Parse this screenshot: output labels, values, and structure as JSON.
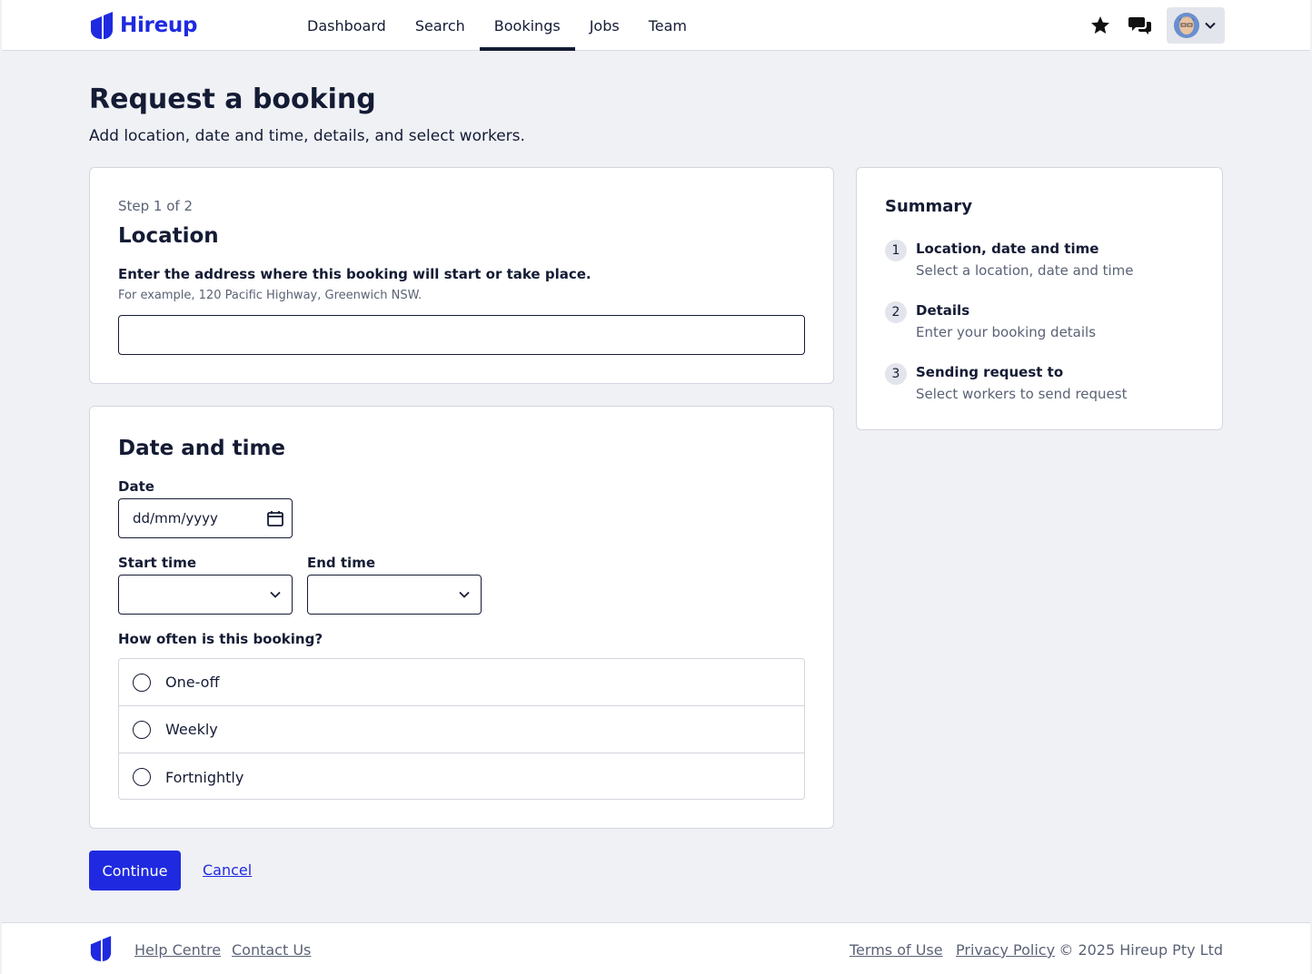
{
  "brand": {
    "name": "Hireup",
    "color": "#1f2ae0"
  },
  "nav": {
    "items": [
      {
        "label": "Dashboard"
      },
      {
        "label": "Search"
      },
      {
        "label": "Bookings",
        "active": true
      },
      {
        "label": "Jobs"
      },
      {
        "label": "Team"
      }
    ]
  },
  "header_icons": [
    "star-icon",
    "chat-icon",
    "avatar",
    "chevron-down-icon"
  ],
  "page": {
    "title": "Request a booking",
    "subtitle": "Add location, date and time, details, and select workers."
  },
  "location": {
    "step": "Step 1 of 2",
    "title": "Location",
    "label": "Enter the address where this booking will start or take place.",
    "hint": "For example, 120 Pacific Highway, Greenwich NSW.",
    "value": ""
  },
  "datetime": {
    "title": "Date and time",
    "date_label": "Date",
    "date_placeholder": "dd/mm/yyyy",
    "start_label": "Start time",
    "end_label": "End time",
    "start_value": "",
    "end_value": "",
    "freq_label": "How often is this booking?",
    "options": [
      {
        "label": "One-off"
      },
      {
        "label": "Weekly"
      },
      {
        "label": "Fortnightly"
      }
    ]
  },
  "summary": {
    "title": "Summary",
    "items": [
      {
        "num": "1",
        "title": "Location, date and time",
        "desc": "Select a location, date and time"
      },
      {
        "num": "2",
        "title": "Details",
        "desc": "Enter your booking details"
      },
      {
        "num": "3",
        "title": "Sending request to",
        "desc": "Select workers to send request"
      }
    ]
  },
  "actions": {
    "continue": "Continue",
    "cancel": "Cancel"
  },
  "footer": {
    "help": "Help Centre",
    "contact": "Contact Us",
    "terms": "Terms of Use",
    "privacy": "Privacy Policy",
    "copyright": "© 2025 Hireup Pty Ltd"
  }
}
